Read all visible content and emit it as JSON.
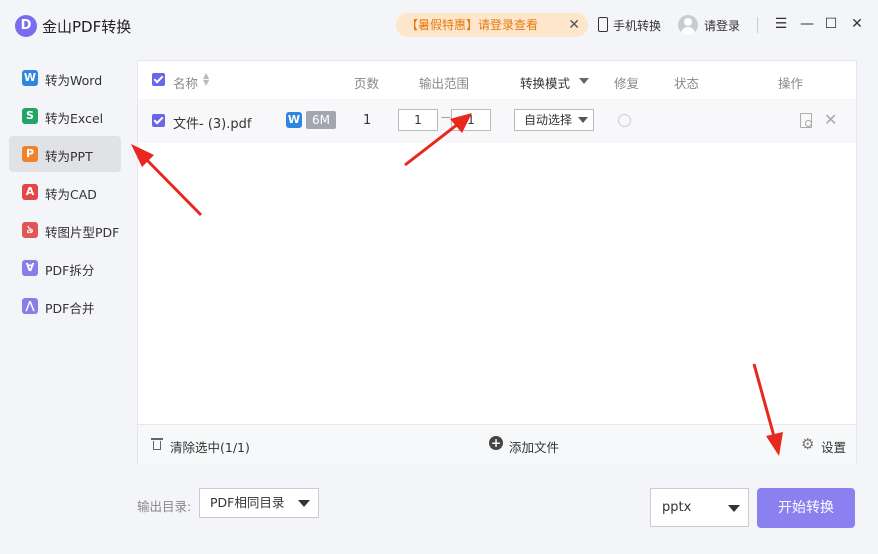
{
  "app": {
    "logo_letter": "D",
    "title": "金山PDF转换"
  },
  "promo": {
    "text": "【暑假特惠】请登录查看",
    "close": "✕"
  },
  "header": {
    "mobile_label": "手机转换",
    "login_label": "请登录"
  },
  "window_controls": {
    "menu": "☰",
    "minimize": "—",
    "maximize": "☐",
    "close": "✕"
  },
  "sidebar": {
    "items": [
      {
        "label": "转为Word",
        "icon": "word-icon",
        "glyph": "W",
        "color": "#2e86de",
        "active": false
      },
      {
        "label": "转为Excel",
        "icon": "excel-icon",
        "glyph": "S",
        "color": "#22a566",
        "active": false
      },
      {
        "label": "转为PPT",
        "icon": "ppt-icon",
        "glyph": "P",
        "color": "#f0822d",
        "active": true
      },
      {
        "label": "转为CAD",
        "icon": "cad-icon",
        "glyph": "A",
        "color": "#e34747",
        "active": false
      },
      {
        "label": "转图片型PDF",
        "icon": "image-pdf-icon",
        "glyph": "৯",
        "color": "#e05656",
        "active": false
      },
      {
        "label": "PDF拆分",
        "icon": "split-icon",
        "glyph": "∀",
        "color": "#8b7ce8",
        "active": false
      },
      {
        "label": "PDF合并",
        "icon": "merge-icon",
        "glyph": "⋀",
        "color": "#8b7ce8",
        "active": false
      }
    ]
  },
  "table": {
    "headers": {
      "name": "名称",
      "pages": "页数",
      "range": "输出范围",
      "mode": "转换模式",
      "repair": "修复",
      "status": "状态",
      "action": "操作"
    },
    "rows": [
      {
        "name": "文件- (3).pdf",
        "file_type_icon": "W",
        "size": "6M",
        "pages": "1",
        "range_from": "1",
        "range_sep": "—",
        "range_to": "1",
        "mode": "自动选择",
        "checked": true
      }
    ]
  },
  "footer": {
    "clear_label": "清除选中(1/1)",
    "add_label": "添加文件",
    "settings_label": "设置"
  },
  "output": {
    "label": "输出目录:",
    "dir_value": "PDF相同目录",
    "format_value": "pptx",
    "start_label": "开始转换"
  },
  "colors": {
    "accent": "#6b66e8",
    "start_button": "#8a80ef",
    "annotation_arrow": "#e8281e",
    "promo_bg": "#fde6cb",
    "promo_text": "#e47a12"
  }
}
